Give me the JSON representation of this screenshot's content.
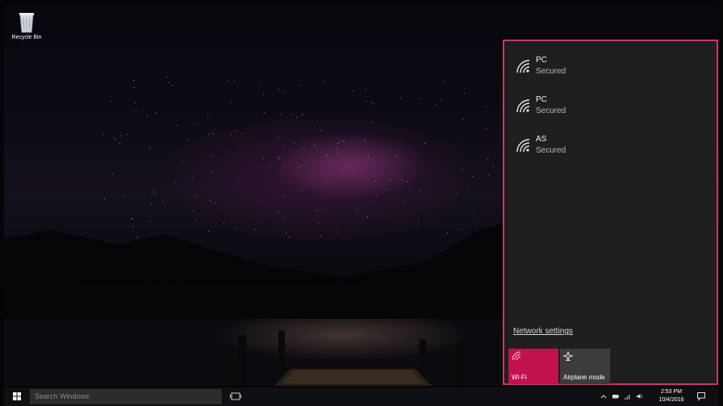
{
  "desktop": {
    "recycle_bin_label": "Recycle Bin"
  },
  "network_flyout": {
    "networks": [
      {
        "ssid": "PC",
        "status": "Secured",
        "icon": "wifi-signal-icon"
      },
      {
        "ssid": "PC",
        "status": "Secured",
        "icon": "wifi-signal-icon"
      },
      {
        "ssid": "AS",
        "status": "Secured",
        "icon": "wifi-signal-icon"
      }
    ],
    "settings_link": "Network settings",
    "quick_actions": [
      {
        "label": "Wi-Fi",
        "active": true,
        "icon": "wifi-icon"
      },
      {
        "label": "Airplane mode",
        "active": false,
        "icon": "airplane-icon"
      }
    ],
    "highlight_color": "#c13a68",
    "active_tile_color": "#c1124f"
  },
  "taskbar": {
    "search_placeholder": "Search Windows",
    "time": "2:53 PM",
    "date": "10/4/2016"
  }
}
